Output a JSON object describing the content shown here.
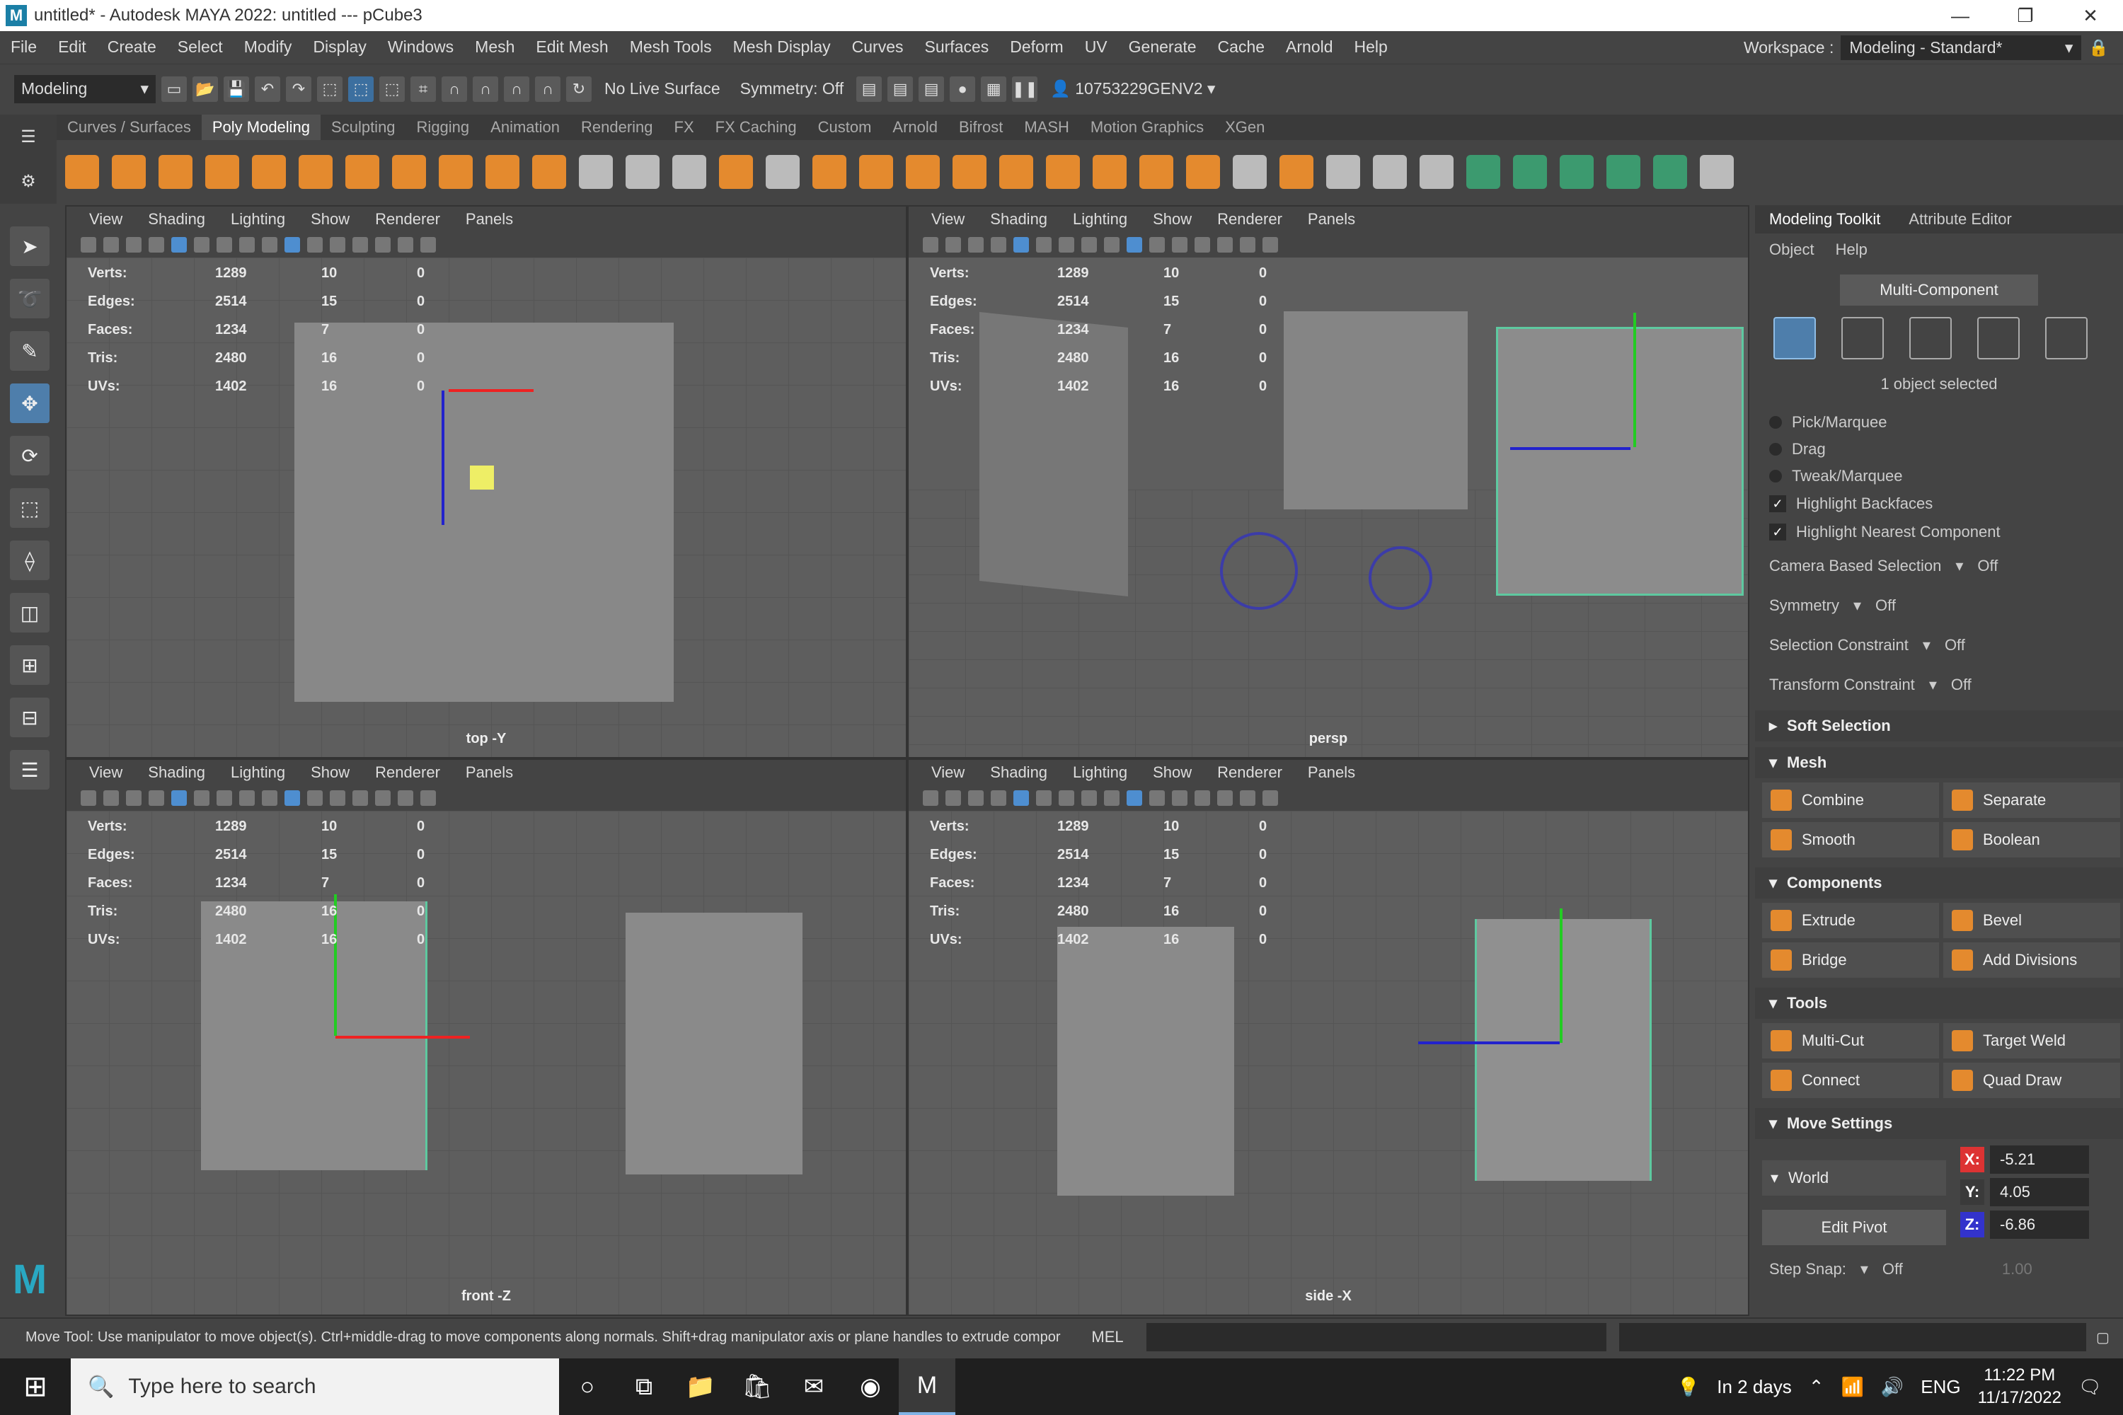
{
  "window": {
    "title": "untitled* - Autodesk MAYA 2022: untitled   ---   pCube3"
  },
  "menubar": {
    "items": [
      "File",
      "Edit",
      "Create",
      "Select",
      "Modify",
      "Display",
      "Windows",
      "Mesh",
      "Edit Mesh",
      "Mesh Tools",
      "Mesh Display",
      "Curves",
      "Surfaces",
      "Deform",
      "UV",
      "Generate",
      "Cache",
      "Arnold",
      "Help"
    ]
  },
  "workspace": {
    "label": "Workspace :",
    "value": "Modeling - Standard*"
  },
  "statusline": {
    "mode": "Modeling",
    "live_surface": "No Live Surface",
    "symmetry": "Symmetry: Off",
    "user": "10753229GENV2"
  },
  "shelf": {
    "tabs": [
      "Curves / Surfaces",
      "Poly Modeling",
      "Sculpting",
      "Rigging",
      "Animation",
      "Rendering",
      "FX",
      "FX Caching",
      "Custom",
      "Arnold",
      "Bifrost",
      "MASH",
      "Motion Graphics",
      "XGen"
    ],
    "active": "Poly Modeling"
  },
  "viewport_menu": [
    "View",
    "Shading",
    "Lighting",
    "Show",
    "Renderer",
    "Panels"
  ],
  "hud": {
    "labels": [
      "Verts:",
      "Edges:",
      "Faces:",
      "Tris:",
      "UVs:"
    ],
    "col1": [
      "1289",
      "2514",
      "1234",
      "2480",
      "1402"
    ],
    "col2": [
      "10",
      "15",
      "7",
      "16",
      "16"
    ],
    "col3": [
      "0",
      "0",
      "0",
      "0",
      "0"
    ]
  },
  "viewports": {
    "top": "top -Y",
    "persp": "persp",
    "front": "front -Z",
    "side": "side -X"
  },
  "panel": {
    "tabs": [
      "Modeling Toolkit",
      "Attribute Editor"
    ],
    "menu": [
      "Object",
      "Help"
    ],
    "multi_component": "Multi-Component",
    "selected": "1 object selected",
    "radios": [
      "Pick/Marquee",
      "Drag",
      "Tweak/Marquee"
    ],
    "checks": [
      "Highlight Backfaces",
      "Highlight Nearest Component"
    ],
    "options": [
      {
        "label": "Camera Based Selection",
        "value": "Off"
      },
      {
        "label": "Symmetry",
        "value": "Off"
      },
      {
        "label": "Selection Constraint",
        "value": "Off"
      },
      {
        "label": "Transform Constraint",
        "value": "Off"
      }
    ],
    "sections": {
      "soft": "Soft Selection",
      "mesh": "Mesh",
      "components": "Components",
      "tools": "Tools",
      "move": "Move Settings"
    },
    "mesh_buttons": [
      "Combine",
      "Separate",
      "Smooth",
      "Boolean"
    ],
    "component_buttons": [
      "Extrude",
      "Bevel",
      "Bridge",
      "Add Divisions"
    ],
    "tool_buttons": [
      "Multi-Cut",
      "Target Weld",
      "Connect",
      "Quad Draw"
    ],
    "move": {
      "space": "World",
      "x": "-5.21",
      "y": "4.05",
      "z": "-6.86",
      "edit_pivot": "Edit Pivot",
      "step_snap": "Step Snap:",
      "step_value": "Off",
      "step_amount": "1.00"
    }
  },
  "helpline": {
    "message": "Move Tool: Use manipulator to move object(s). Ctrl+middle-drag to move components along normals. Shift+drag manipulator axis or plane handles to extrude compor",
    "mel": "MEL"
  },
  "taskbar": {
    "search": "Type here to search",
    "weather": "In 2 days",
    "lang": "ENG",
    "time": "11:22 PM",
    "date": "11/17/2022"
  }
}
